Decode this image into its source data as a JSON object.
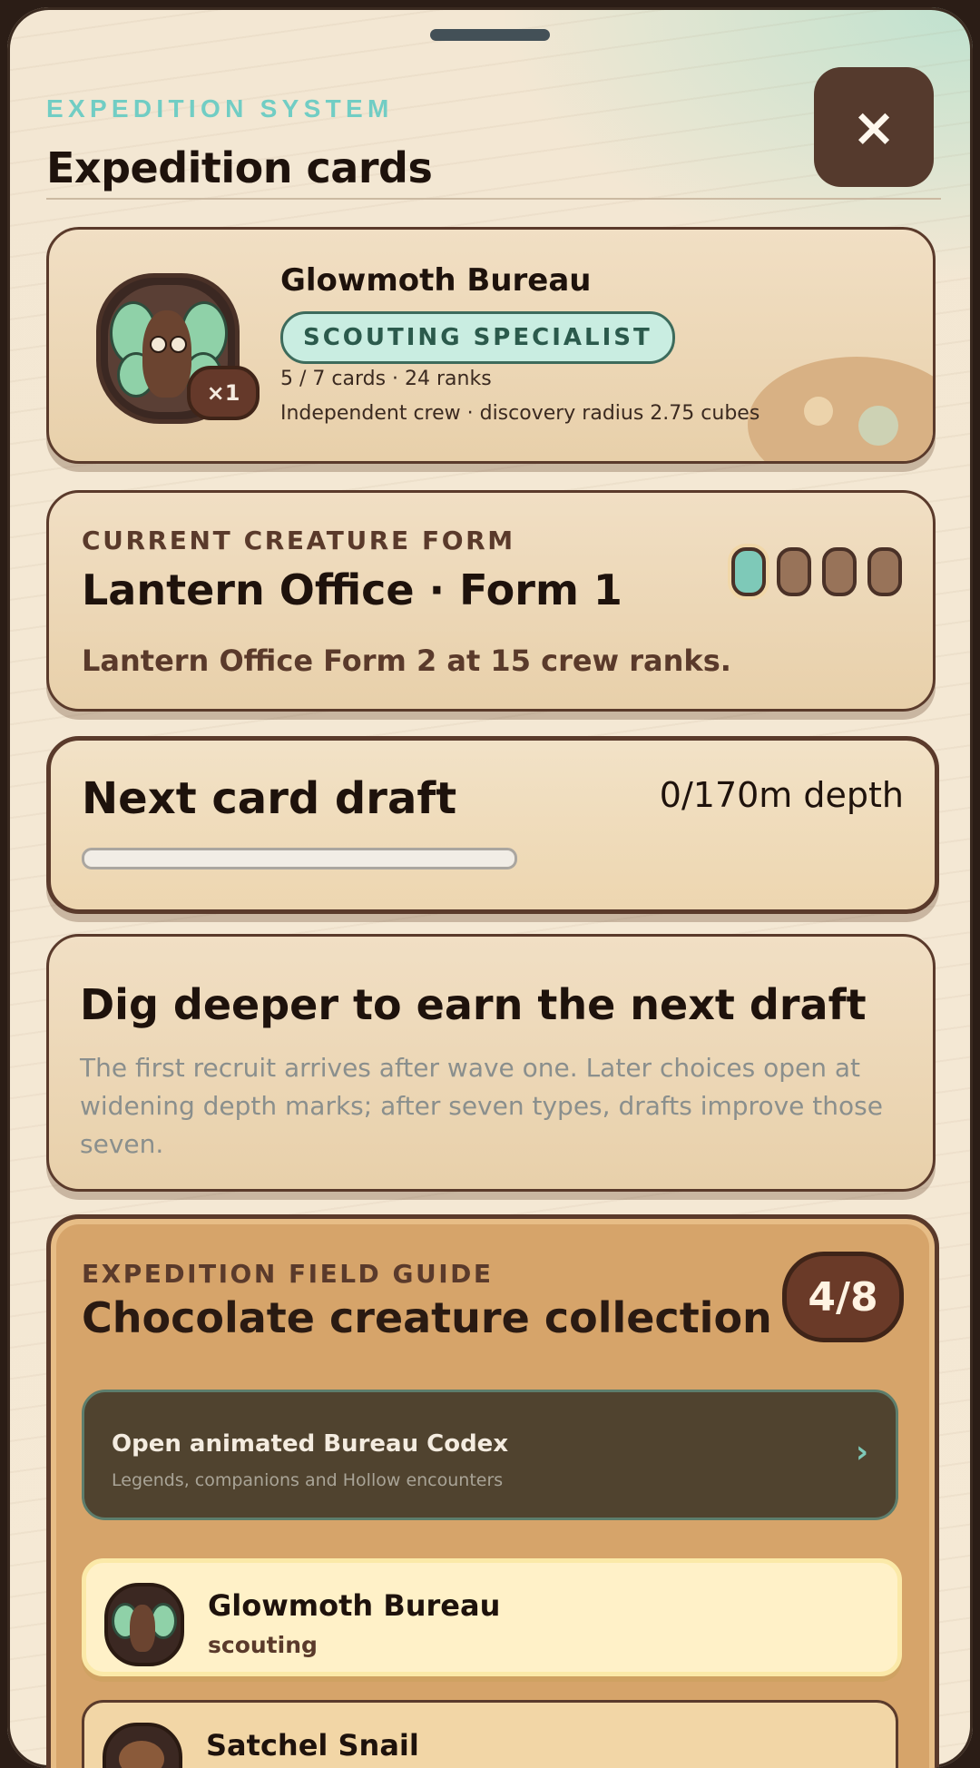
{
  "header": {
    "eyebrow": "EXPEDITION SYSTEM",
    "title": "Expedition cards",
    "close_label": "×"
  },
  "bureau_card": {
    "name": "Glowmoth Bureau",
    "tag": "SCOUTING SPECIALIST",
    "count_badge": "×1",
    "cards_line": "5 / 7 cards · 24 ranks",
    "crew_line": "Independent crew · discovery radius 2.75 cubes"
  },
  "form_card": {
    "eyebrow": "CURRENT CREATURE FORM",
    "title": "Lantern Office · Form 1",
    "next_form": "Lantern Office Form 2 at 15 crew ranks.",
    "forms_total": 4,
    "forms_unlocked": 1
  },
  "draft_card": {
    "title": "Next card draft",
    "depth": "0/170m depth",
    "progress": 0
  },
  "hint_card": {
    "title": "Dig deeper to earn the next draft",
    "body": "The first recruit arrives after wave one. Later choices open at widening depth marks; after seven types, drafts improve those seven."
  },
  "field_guide": {
    "eyebrow": "EXPEDITION FIELD GUIDE",
    "title": "Chocolate creature collection",
    "count": "4/8",
    "codex": {
      "title": "Open animated Bureau Codex",
      "subtitle": "Legends, companions and Hollow encounters",
      "chevron": "›"
    },
    "creatures": [
      {
        "name": "Glowmoth Bureau",
        "role": "scouting"
      },
      {
        "name": "Satchel Snail",
        "role": ""
      }
    ]
  },
  "colors": {
    "accent_teal": "#71cdc4",
    "brown_dark": "#553a2d",
    "tag_bg": "#c9ede1",
    "guide_bg": "#d6a46a"
  },
  "icons": {
    "close": "close-icon",
    "codex_chevron": "chevron-right-icon"
  }
}
